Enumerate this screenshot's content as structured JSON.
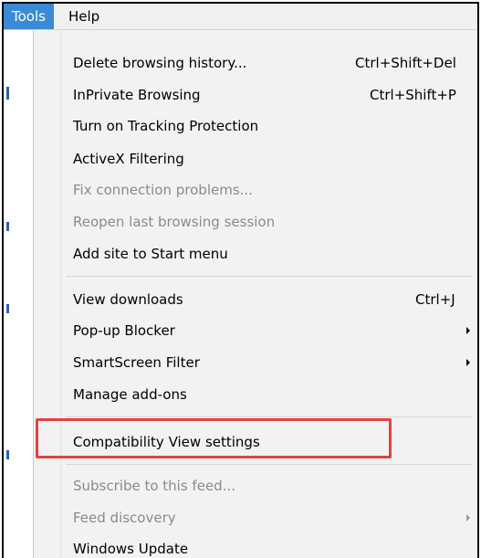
{
  "menubar": {
    "tools": "Tools",
    "help": "Help"
  },
  "menu": {
    "items": [
      {
        "label": "Delete browsing history...",
        "shortcut": "Ctrl+Shift+Del"
      },
      {
        "label": "InPrivate Browsing",
        "shortcut": "Ctrl+Shift+P"
      },
      {
        "label": "Turn on Tracking Protection"
      },
      {
        "label": "ActiveX Filtering"
      },
      {
        "label": "Fix connection problems...",
        "disabled": true
      },
      {
        "label": "Reopen last browsing session",
        "disabled": true
      },
      {
        "label": "Add site to Start menu"
      },
      {
        "label": "View downloads",
        "shortcut": "Ctrl+J"
      },
      {
        "label": "Pop-up Blocker",
        "submenu": true
      },
      {
        "label": "SmartScreen Filter",
        "submenu": true
      },
      {
        "label": "Manage add-ons"
      },
      {
        "label": "Compatibility View settings",
        "highlighted": true
      },
      {
        "label": "Subscribe to this feed...",
        "disabled": true
      },
      {
        "label": "Feed discovery",
        "disabled": true,
        "submenu": true
      },
      {
        "label": "Windows Update"
      }
    ]
  },
  "colors": {
    "menubar_active": "#3a8ad6",
    "highlight_box": "#e0443f",
    "disabled_text": "#8a8a8a"
  }
}
